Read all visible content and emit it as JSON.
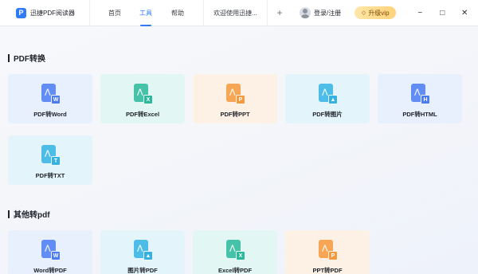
{
  "app": {
    "name": "迅捷PDF阅读器",
    "logo_letter": "P"
  },
  "tabs": [
    {
      "label": "首页",
      "active": false
    },
    {
      "label": "工具",
      "active": true
    },
    {
      "label": "帮助",
      "active": false
    },
    {
      "label": "欢迎使用迅捷...",
      "active": false
    }
  ],
  "add_tab_label": "+",
  "login_label": "登录/注册",
  "vip_label": "升级vip",
  "window_controls": {
    "minimize": "−",
    "maximize": "□",
    "close": "✕"
  },
  "sections": [
    {
      "title": "PDF转换",
      "items": [
        {
          "label": "PDF转Word",
          "badge": "W",
          "bg": "#e8effd",
          "color": "#4a7cf4"
        },
        {
          "label": "PDF转Excel",
          "badge": "X",
          "bg": "#e2f7f3",
          "color": "#2bb99b"
        },
        {
          "label": "PDF转PPT",
          "badge": "P",
          "bg": "#fdf1e6",
          "color": "#f59a3c"
        },
        {
          "label": "PDF转图片",
          "badge": "▲",
          "bg": "#e3f5fb",
          "color": "#34b3e3"
        },
        {
          "label": "PDF转HTML",
          "badge": "H",
          "bg": "#e8effd",
          "color": "#4a7cf4"
        },
        {
          "label": "PDF转TXT",
          "badge": "T",
          "bg": "#e3f5fb",
          "color": "#34b3e3"
        }
      ]
    },
    {
      "title": "其他转pdf",
      "items": [
        {
          "label": "Word转PDF",
          "badge": "W",
          "bg": "#e8effd",
          "color": "#4a7cf4"
        },
        {
          "label": "图片转PDF",
          "badge": "▲",
          "bg": "#e3f5fb",
          "color": "#34b3e3"
        },
        {
          "label": "Excel转PDF",
          "badge": "X",
          "bg": "#e2f7f3",
          "color": "#2bb99b"
        },
        {
          "label": "PPT转PDF",
          "badge": "P",
          "bg": "#fdf1e6",
          "color": "#f59a3c"
        }
      ]
    }
  ]
}
